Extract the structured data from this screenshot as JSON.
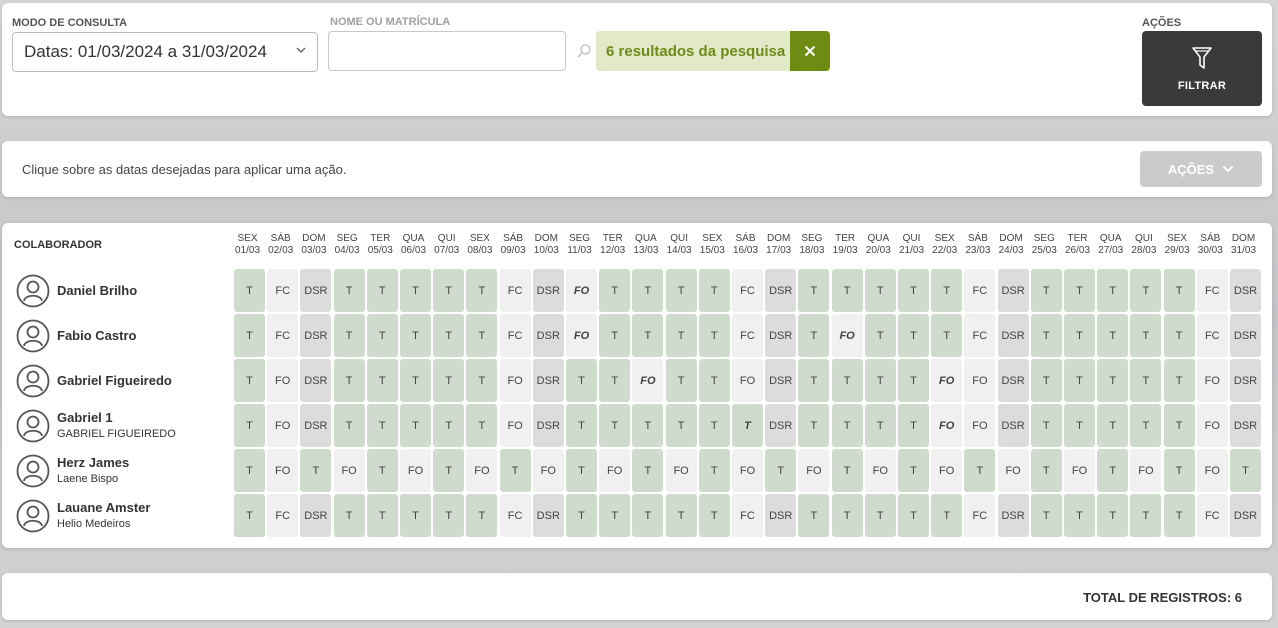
{
  "filters": {
    "mode_label": "MODO DE CONSULTA",
    "mode_value": "Datas: 01/03/2024 a 31/03/2024",
    "search_label": "NOME OU MATRÍCULA",
    "search_value": "",
    "search_placeholder": "",
    "results_text": "6 resultados da pesquisa",
    "actions_label": "AÇÕES",
    "filter_button": "FILTRAR"
  },
  "actions_bar": {
    "hint": "Clique sobre as datas desejadas para aplicar uma ação.",
    "button": "AÇÕES"
  },
  "grid": {
    "collaborator_header": "COLABORADOR",
    "days": [
      {
        "wd": "SEX",
        "d": "01/03"
      },
      {
        "wd": "SÁB",
        "d": "02/03"
      },
      {
        "wd": "DOM",
        "d": "03/03"
      },
      {
        "wd": "SEG",
        "d": "04/03"
      },
      {
        "wd": "TER",
        "d": "05/03"
      },
      {
        "wd": "QUA",
        "d": "06/03"
      },
      {
        "wd": "QUI",
        "d": "07/03"
      },
      {
        "wd": "SEX",
        "d": "08/03"
      },
      {
        "wd": "SÁB",
        "d": "09/03"
      },
      {
        "wd": "DOM",
        "d": "10/03"
      },
      {
        "wd": "SEG",
        "d": "11/03"
      },
      {
        "wd": "TER",
        "d": "12/03"
      },
      {
        "wd": "QUA",
        "d": "13/03"
      },
      {
        "wd": "QUI",
        "d": "14/03"
      },
      {
        "wd": "SEX",
        "d": "15/03"
      },
      {
        "wd": "SÁB",
        "d": "16/03"
      },
      {
        "wd": "DOM",
        "d": "17/03"
      },
      {
        "wd": "SEG",
        "d": "18/03"
      },
      {
        "wd": "TER",
        "d": "19/03"
      },
      {
        "wd": "QUA",
        "d": "20/03"
      },
      {
        "wd": "QUI",
        "d": "21/03"
      },
      {
        "wd": "SEX",
        "d": "22/03"
      },
      {
        "wd": "SÁB",
        "d": "23/03"
      },
      {
        "wd": "DOM",
        "d": "24/03"
      },
      {
        "wd": "SEG",
        "d": "25/03"
      },
      {
        "wd": "TER",
        "d": "26/03"
      },
      {
        "wd": "QUA",
        "d": "27/03"
      },
      {
        "wd": "QUI",
        "d": "28/03"
      },
      {
        "wd": "SEX",
        "d": "29/03"
      },
      {
        "wd": "SÁB",
        "d": "30/03"
      },
      {
        "wd": "DOM",
        "d": "31/03"
      }
    ],
    "employees": [
      {
        "name": "Daniel Brilho",
        "sub": "",
        "cells": [
          "T",
          "FC",
          "DSR",
          "T",
          "T",
          "T",
          "T",
          "T",
          "FC",
          "DSR",
          "FO*",
          "T",
          "T",
          "T",
          "T",
          "FC",
          "DSR",
          "T",
          "T",
          "T",
          "T",
          "T",
          "FC",
          "DSR",
          "T",
          "T",
          "T",
          "T",
          "T",
          "FC",
          "DSR"
        ]
      },
      {
        "name": "Fabio Castro",
        "sub": "",
        "cells": [
          "T",
          "FC",
          "DSR",
          "T",
          "T",
          "T",
          "T",
          "T",
          "FC",
          "DSR",
          "FO*",
          "T",
          "T",
          "T",
          "T",
          "FC",
          "DSR",
          "T",
          "FO*",
          "T",
          "T",
          "T",
          "FC",
          "DSR",
          "T",
          "T",
          "T",
          "T",
          "T",
          "FC",
          "DSR"
        ]
      },
      {
        "name": "Gabriel Figueiredo",
        "sub": "",
        "cells": [
          "T",
          "FO",
          "DSR",
          "T",
          "T",
          "T",
          "T",
          "T",
          "FO",
          "DSR",
          "T",
          "T",
          "FO*",
          "T",
          "T",
          "FO",
          "DSR",
          "T",
          "T",
          "T",
          "T",
          "FO*",
          "FO",
          "DSR",
          "T",
          "T",
          "T",
          "T",
          "T",
          "FO",
          "DSR"
        ]
      },
      {
        "name": "Gabriel 1",
        "sub": "GABRIEL FIGUEIREDO",
        "cells": [
          "T",
          "FO",
          "DSR",
          "T",
          "T",
          "T",
          "T",
          "T",
          "FO",
          "DSR",
          "T",
          "T",
          "T",
          "T",
          "T",
          "T*",
          "DSR",
          "T",
          "T",
          "T",
          "T",
          "FO*",
          "FO",
          "DSR",
          "T",
          "T",
          "T",
          "T",
          "T",
          "FO",
          "DSR"
        ]
      },
      {
        "name": "Herz James",
        "sub": "Laene Bispo",
        "cells": [
          "T",
          "FO",
          "T",
          "FO",
          "T",
          "FO",
          "T",
          "FO",
          "T",
          "FO",
          "T",
          "FO",
          "T",
          "FO",
          "T",
          "FO",
          "T",
          "FO",
          "T",
          "FO",
          "T",
          "FO",
          "T",
          "FO",
          "T",
          "FO",
          "T",
          "FO",
          "T",
          "FO",
          "T"
        ]
      },
      {
        "name": "Lauane Amster",
        "sub": "Helio Medeiros",
        "cells": [
          "T",
          "FC",
          "DSR",
          "T",
          "T",
          "T",
          "T",
          "T",
          "FC",
          "DSR",
          "T",
          "T",
          "T",
          "T",
          "T",
          "FC",
          "DSR",
          "T",
          "T",
          "T",
          "T",
          "T",
          "FC",
          "DSR",
          "T",
          "T",
          "T",
          "T",
          "T",
          "FC",
          "DSR"
        ]
      }
    ]
  },
  "footer": {
    "total": "TOTAL DE REGISTROS: 6"
  },
  "icons": {
    "chevron": "chevron-down-icon",
    "search": "search-icon",
    "clear": "close-icon",
    "filter": "funnel-icon",
    "avatar": "user-avatar-icon"
  },
  "colors": {
    "worked": "#cfdbcc",
    "off": "#f0f0f0",
    "dsr": "#dcdcdc",
    "badge_bg": "#e2e9c9",
    "badge_text": "#6f8a18",
    "badge_close": "#6e8c12",
    "filter_button": "#3a3a3a"
  }
}
